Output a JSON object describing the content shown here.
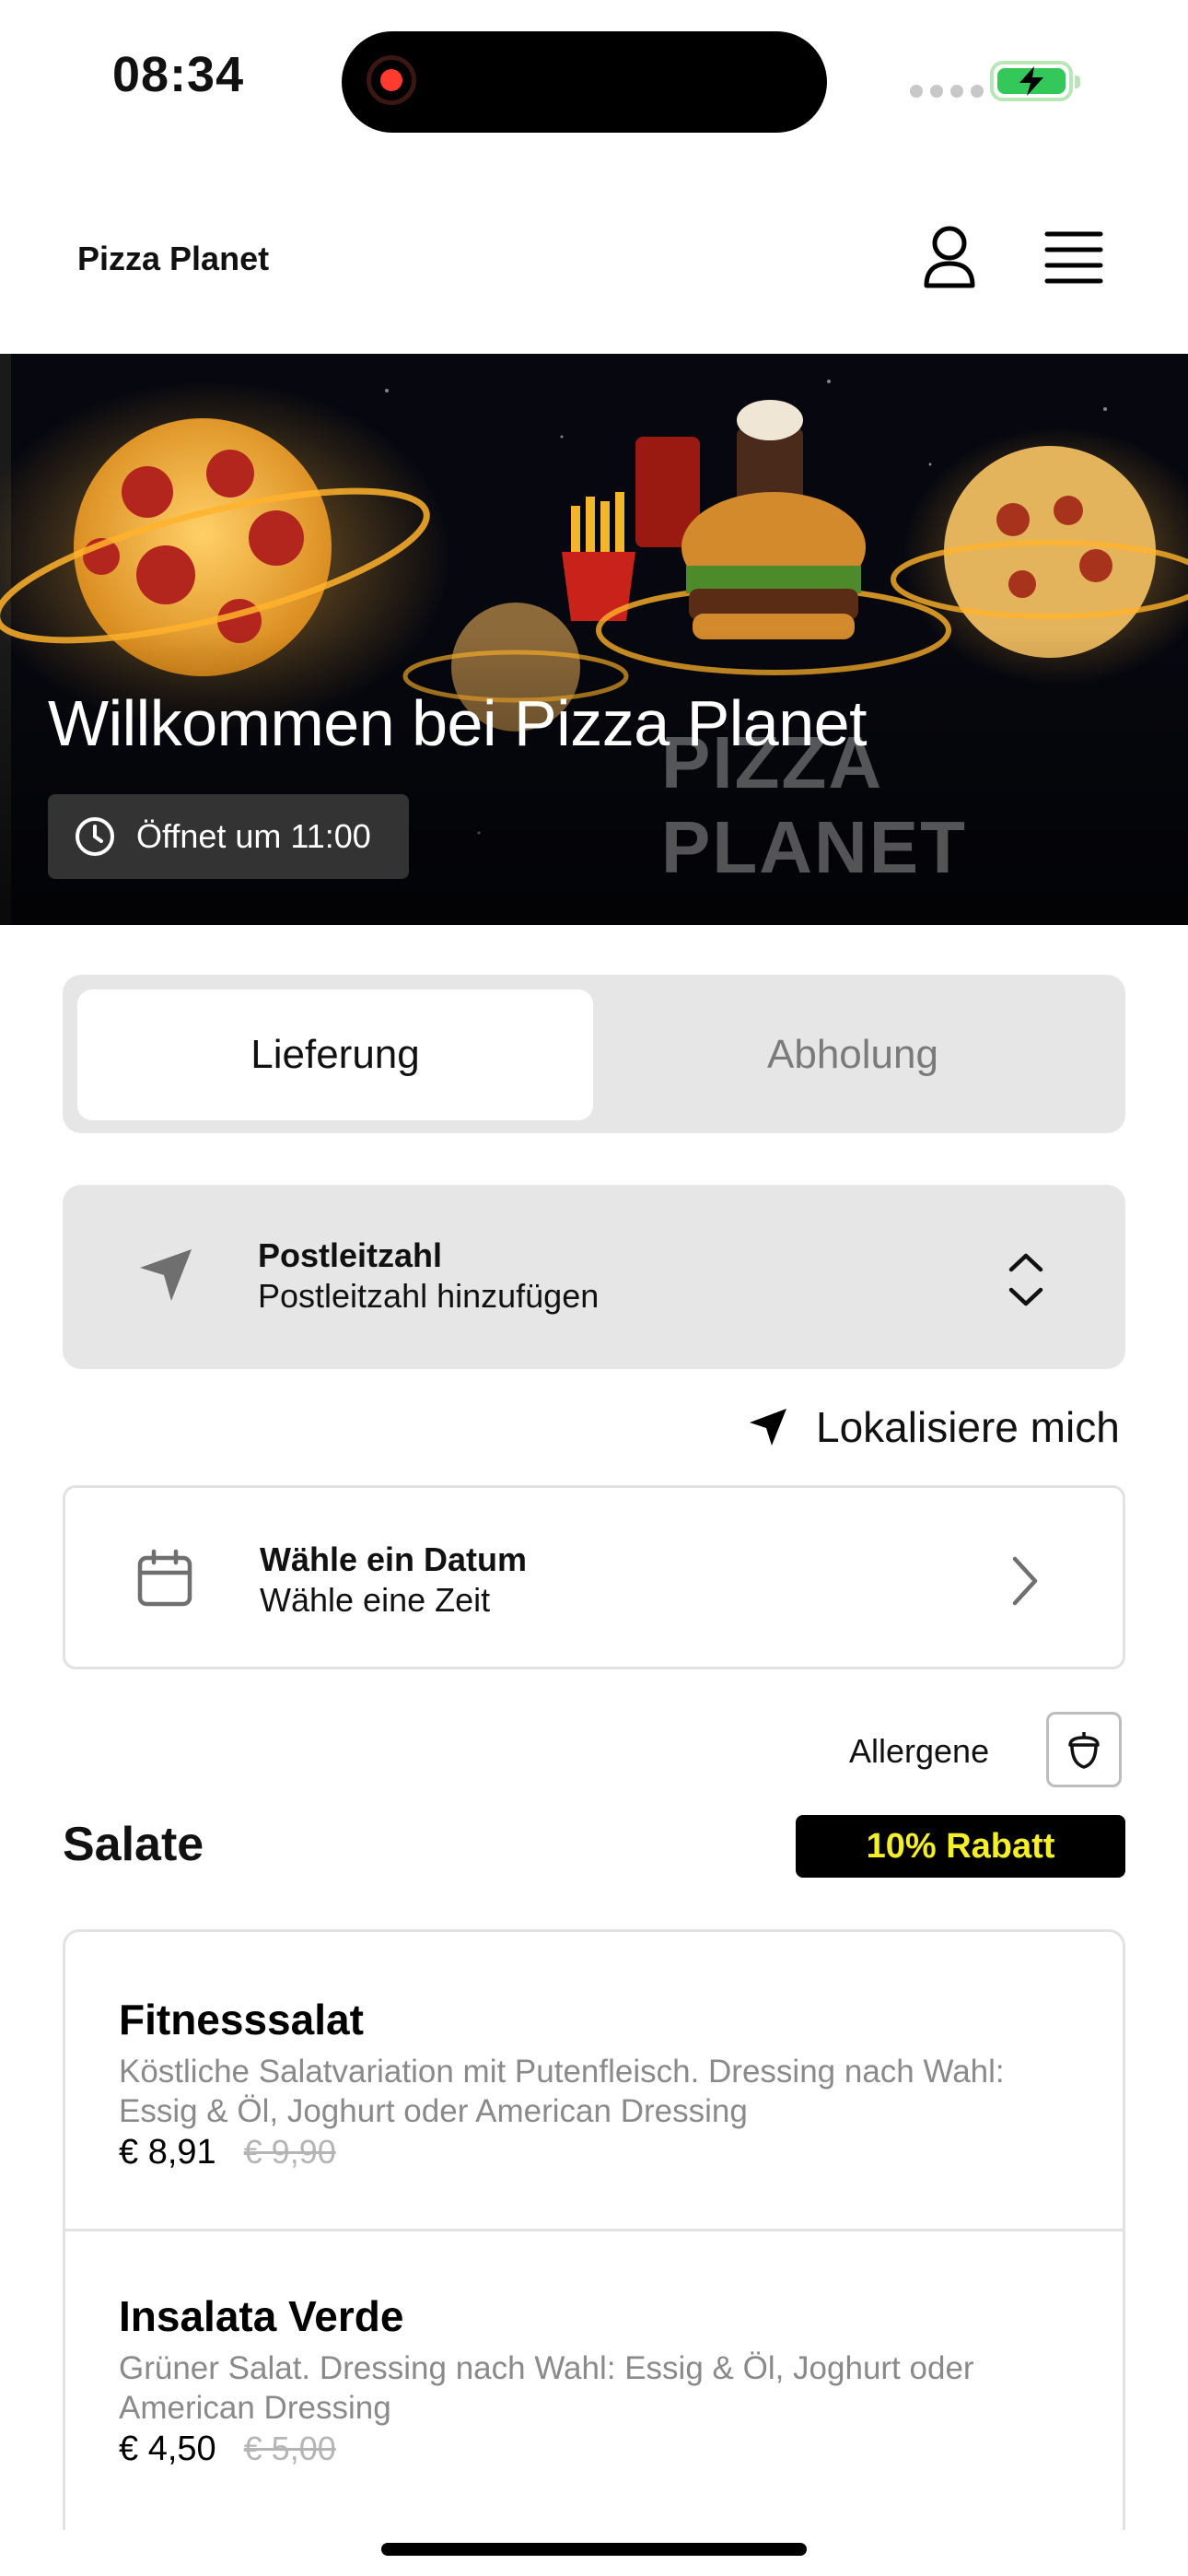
{
  "status_bar": {
    "time": "08:34"
  },
  "header": {
    "brand": "Pizza Planet"
  },
  "hero": {
    "title": "Willkommen bei Pizza Planet",
    "watermark": "PIZZA PLANET",
    "opening_info": "Öffnet um 11:00"
  },
  "order_mode": {
    "tabs": [
      {
        "label": "Lieferung",
        "selected": true
      },
      {
        "label": "Abholung",
        "selected": false
      }
    ]
  },
  "postcode": {
    "title": "Postleitzahl",
    "placeholder": "Postleitzahl hinzufügen"
  },
  "locate": {
    "label": "Lokalisiere mich"
  },
  "schedule": {
    "title": "Wähle ein Datum",
    "subtitle": "Wähle eine Zeit"
  },
  "allergens": {
    "label": "Allergene"
  },
  "section": {
    "title": "Salate",
    "badge": "10% Rabatt"
  },
  "products": [
    {
      "name": "Fitnesssalat",
      "description": "Köstliche Salatvariation mit Putenfleisch. Dressing nach Wahl: Essig & Öl, Joghurt oder American Dressing",
      "price": "€ 8,91",
      "old_price": "€ 9,90"
    },
    {
      "name": "Insalata Verde",
      "description": "Grüner Salat. Dressing nach Wahl: Essig & Öl, Joghurt oder American Dressing",
      "price": "€ 4,50",
      "old_price": "€ 5,00"
    }
  ],
  "colors": {
    "accent_yellow": "#f5ee2a",
    "battery_green": "#34c759",
    "record_red": "#ff3b30"
  }
}
